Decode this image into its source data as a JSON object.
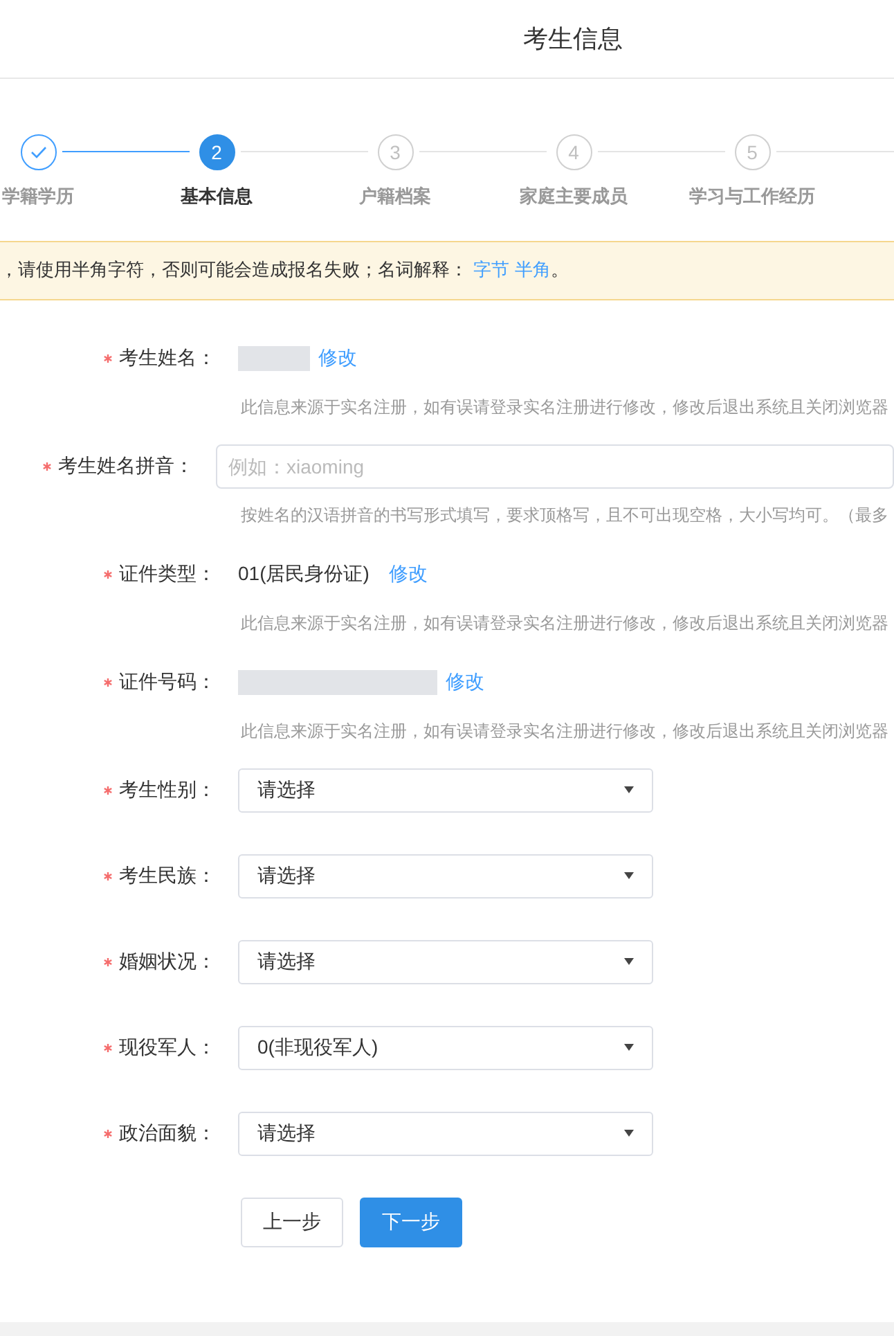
{
  "header": {
    "title": "考生信息"
  },
  "steps": [
    {
      "label": "学籍学历",
      "done": true,
      "selected": false
    },
    {
      "number": "2",
      "label": "基本信息",
      "done": false,
      "selected": true
    },
    {
      "number": "3",
      "label": "户籍档案",
      "done": false,
      "selected": false
    },
    {
      "number": "4",
      "label": "家庭主要成员",
      "done": false,
      "selected": false
    },
    {
      "number": "5",
      "label": "学习与工作经历",
      "done": false,
      "selected": false
    }
  ],
  "notice": {
    "text": "，请使用半角字符，否则可能会造成报名失败；名词解释：",
    "links": [
      "字节",
      "半角"
    ],
    "end": "。"
  },
  "fields": [
    {
      "kind": "redacted_short",
      "label": "考生姓名：",
      "required": true,
      "action": "修改",
      "hint": "此信息来源于实名注册，如有误请登录实名注册进行修改，修改后退出系统且关闭浏览器"
    },
    {
      "kind": "input",
      "label": "考生姓名拼音：",
      "required": true,
      "placeholder": "例如：xiaoming",
      "hint": "按姓名的汉语拼音的书写形式填写，要求顶格写，且不可出现空格，大小写均可。（最多"
    },
    {
      "kind": "readonly",
      "label": "证件类型：",
      "required": true,
      "value": "01(居民身份证)",
      "action": "修改",
      "hint": "此信息来源于实名注册，如有误请登录实名注册进行修改，修改后退出系统且关闭浏览器"
    },
    {
      "kind": "redacted_long",
      "label": "证件号码：",
      "required": true,
      "action": "修改",
      "hint": "此信息来源于实名注册，如有误请登录实名注册进行修改，修改后退出系统且关闭浏览器"
    },
    {
      "kind": "select",
      "label": "考生性别：",
      "required": true,
      "value": "请选择"
    },
    {
      "kind": "select",
      "label": "考生民族：",
      "required": true,
      "value": "请选择"
    },
    {
      "kind": "select",
      "label": "婚姻状况：",
      "required": true,
      "value": "请选择"
    },
    {
      "kind": "select",
      "label": "现役军人：",
      "required": true,
      "value": "0(非现役军人)"
    },
    {
      "kind": "select",
      "label": "政治面貌：",
      "required": true,
      "value": "请选择"
    }
  ],
  "buttons": [
    {
      "label": "上一步",
      "kind": "secondary"
    },
    {
      "label": "下一步",
      "kind": "primary"
    }
  ]
}
